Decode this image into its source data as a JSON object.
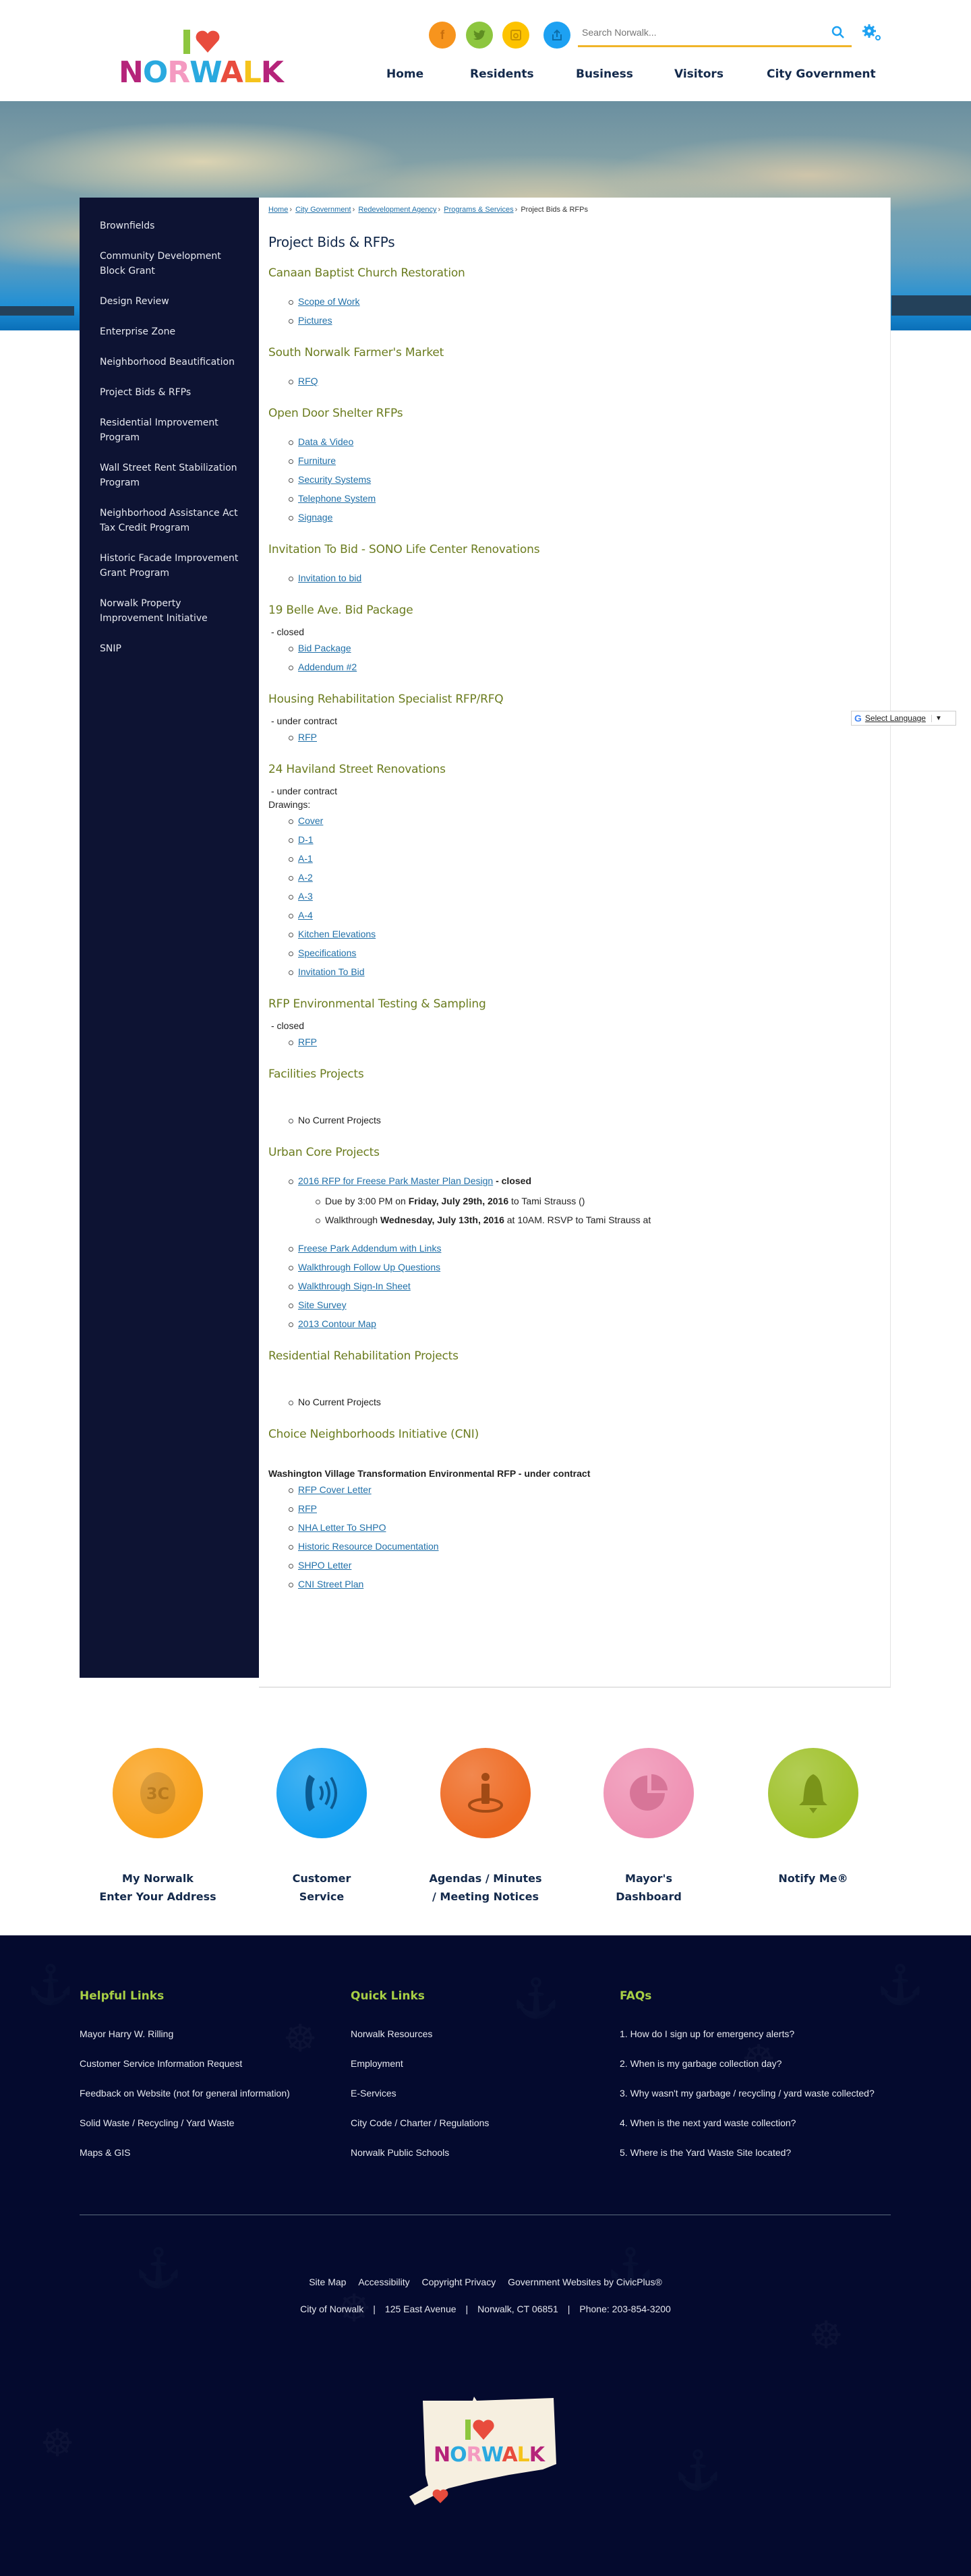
{
  "header": {
    "logo_word": [
      "N",
      "O",
      "R",
      "W",
      "A",
      "L",
      "K"
    ],
    "logo_alt": "I love Norwalk",
    "social": [
      {
        "name": "facebook",
        "glyph": "f"
      },
      {
        "name": "twitter",
        "glyph": "t"
      },
      {
        "name": "instagram",
        "glyph": "◎"
      },
      {
        "name": "share",
        "glyph": "⇪"
      }
    ],
    "search": {
      "placeholder": "Search Norwalk...",
      "value": ""
    },
    "nav": [
      "Home",
      "Residents",
      "Business",
      "Visitors",
      "City Government"
    ]
  },
  "sidebar": {
    "items": [
      "Brownfields",
      "Community Development Block Grant",
      "Design Review",
      "Enterprise Zone",
      "Neighborhood Beautification",
      "Project Bids & RFPs",
      "Residential Improvement Program",
      "Wall Street Rent Stabilization Program",
      "Neighborhood Assistance Act Tax Credit Program",
      "Historic Facade Improvement Grant Program",
      "Norwalk Property Improvement Initiative",
      "SNIP"
    ]
  },
  "breadcrumb": {
    "links": [
      "Home",
      "City Government",
      "Redevelopment Agency",
      "Programs & Services"
    ],
    "current": "Project Bids & RFPs",
    "separator": "›"
  },
  "page_title": "Project Bids & RFPs",
  "sections": {
    "canaan": {
      "title": "Canaan Baptist Church Restoration",
      "links": [
        "Scope of Work",
        "Pictures"
      ]
    },
    "farmers": {
      "title": "South Norwalk Farmer's Market",
      "links": [
        "RFQ"
      ]
    },
    "opendoor": {
      "title": "Open Door Shelter RFPs",
      "links": [
        "Data & Video",
        "Furniture",
        "Security Systems",
        "Telephone System",
        "Signage"
      ]
    },
    "sono": {
      "title": "Invitation To Bid - SONO Life Center Renovations",
      "links": [
        "Invitation to bid"
      ]
    },
    "belle": {
      "title": "19 Belle Ave. Bid Package",
      "status": "- closed",
      "links": [
        "Bid Package",
        "Addendum #2"
      ]
    },
    "housing": {
      "title": "Housing Rehabilitation Specialist RFP/RFQ",
      "status": "- under contract",
      "links": [
        "RFP"
      ]
    },
    "haviland": {
      "title": "24 Haviland Street Renovations",
      "status": "- under contract",
      "drawings_label": "Drawings:",
      "links": [
        "Cover",
        "D-1",
        "A-1",
        "A-2",
        "A-3",
        "A-4",
        "Kitchen Elevations",
        "Specifications",
        "Invitation To Bid"
      ]
    },
    "environmental": {
      "title": "RFP Environmental Testing & Sampling",
      "status": "- closed",
      "links": [
        "RFP"
      ]
    },
    "facilities": {
      "title": "Facilities Projects",
      "items": [
        "No Current Projects"
      ]
    },
    "urban": {
      "title": "Urban Core Projects",
      "main_link": "2016 RFP for Freese Park Master Plan Design",
      "main_status": " - closed",
      "due": {
        "prefix": "Due by 3:00 PM on ",
        "bold": "Friday, July 29th, 2016",
        "suffix": " to Tami Strauss ()"
      },
      "walk": {
        "prefix": "Walkthrough ",
        "bold": "Wednesday, July 13th, 2016",
        "suffix": " at 10AM. RSVP to Tami Strauss at"
      },
      "links": [
        "Freese Park Addendum with Links",
        "Walkthrough Follow Up Questions",
        "Walkthrough Sign-In Sheet",
        "Site Survey",
        "2013 Contour Map"
      ]
    },
    "residential": {
      "title": "Residential Rehabilitation Projects",
      "items": [
        "No Current Projects"
      ]
    },
    "cni": {
      "title": "Choice Neighborhoods Initiative (CNI)",
      "subtitle": "Washington Village Transformation Environmental RFP - under contract",
      "links": [
        "RFP Cover Letter",
        "RFP",
        "NHA Letter To SHPO",
        "Historic Resource Documentation",
        "SHPO Letter",
        "CNI Street Plan"
      ]
    }
  },
  "translate": {
    "label": "Select Language",
    "g": "G",
    "arrow": "▼"
  },
  "quick_links": [
    {
      "line1": "My Norwalk",
      "line2": "Enter Your Address",
      "color": "#f9a11b",
      "icon": "map-icon"
    },
    {
      "line1": "Customer",
      "line2": "Service",
      "color": "#139ff0",
      "icon": "phone-icon"
    },
    {
      "line1": "Agendas / Minutes",
      "line2": "/ Meeting Notices",
      "color": "#ee6a22",
      "icon": "podium-icon"
    },
    {
      "line1": "Mayor's",
      "line2": "Dashboard",
      "color": "#ef91b3",
      "icon": "pie-chart-icon"
    },
    {
      "line1": "Notify Me®",
      "line2": "",
      "color": "#9fc12a",
      "icon": "bell-icon"
    }
  ],
  "footer": {
    "helpful": {
      "title": "Helpful Links",
      "items": [
        "Mayor Harry W. Rilling",
        "Customer Service Information Request",
        "Feedback on Website (not for general information)",
        "Solid Waste / Recycling / Yard Waste",
        "Maps & GIS"
      ]
    },
    "quick": {
      "title": "Quick Links",
      "items": [
        "Norwalk Resources",
        "Employment",
        "E-Services",
        "City Code / Charter / Regulations",
        "Norwalk Public Schools"
      ]
    },
    "faqs": {
      "title": "FAQs",
      "items": [
        "1. How do I sign up for emergency alerts?",
        "2. When is my garbage collection day?",
        "3. Why wasn't my garbage / recycling / yard waste collected?",
        "4. When is the next yard waste collection?",
        "5. Where is the Yard Waste Site located?"
      ]
    },
    "bottom_links": [
      "Site Map",
      "Accessibility",
      "Copyright Privacy",
      "Government Websites by CivicPlus®"
    ],
    "address": [
      "City of Norwalk",
      "125 East Avenue",
      "Norwalk, CT  06851",
      "Phone: 203-854-3200"
    ]
  },
  "colors": {
    "navy": "#0d1333",
    "footer_bg": "#040a2e",
    "section_green": "#6b7c1f",
    "link_blue": "#1f6fa8",
    "footer_heading": "#a8cf45",
    "search_underline": "#f0b429"
  }
}
